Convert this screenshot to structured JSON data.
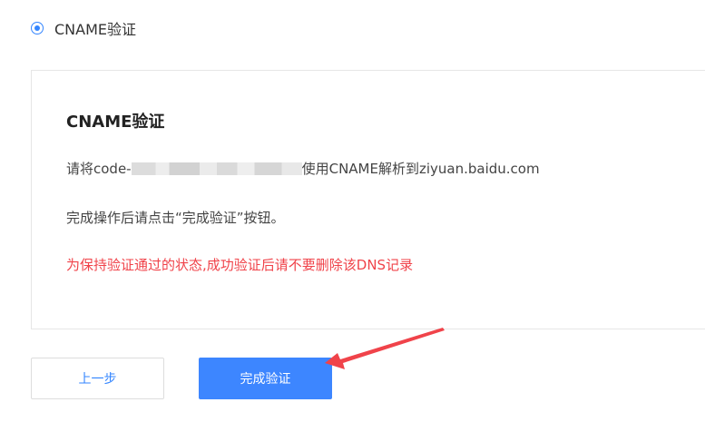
{
  "verification_option": {
    "label": "CNAME验证",
    "selected": true
  },
  "panel": {
    "title": "CNAME验证",
    "instruction_prefix": "请将code-",
    "instruction_suffix": "使用CNAME解析到ziyuan.baidu.com",
    "complete_hint": "完成操作后请点击“完成验证”按钮。",
    "warning": "为保持验证通过的状态,成功验证后请不要删除该DNS记录"
  },
  "buttons": {
    "prev_label": "上一步",
    "complete_label": "完成验证"
  },
  "colors": {
    "accent": "#3d86ff",
    "warning": "#f0434a",
    "arrow": "#f0434a"
  }
}
